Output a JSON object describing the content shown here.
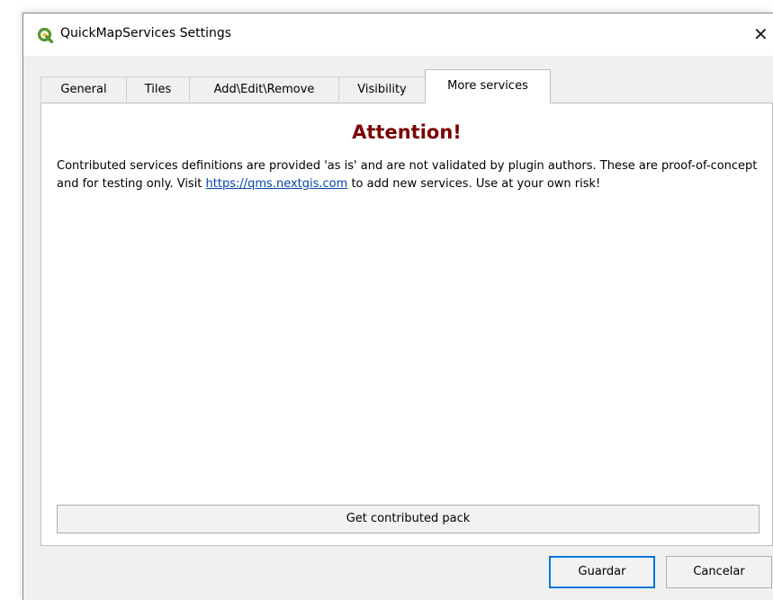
{
  "window": {
    "title": "QuickMapServices Settings",
    "close_glyph": "✕",
    "icon": "qgis-logo-icon",
    "icon_color": "#589632"
  },
  "tabs": [
    {
      "label": "General",
      "active": false
    },
    {
      "label": "Tiles",
      "active": false
    },
    {
      "label": "Add\\Edit\\Remove",
      "active": false
    },
    {
      "label": "Visibility",
      "active": false
    },
    {
      "label": "More services",
      "active": true
    }
  ],
  "more_services": {
    "heading": "Attention!",
    "heading_color": "#7a0000",
    "text_before": "Contributed services definitions are provided 'as is' and are not validated by plugin authors. These are proof-of-concept and for testing only. Visit ",
    "link_text": "https://qms.nextgis.com",
    "link_color": "#0645ad",
    "text_after": " to add new services. Use at your own risk!",
    "get_pack_label": "Get contributed pack"
  },
  "footer": {
    "save_label": "Guardar",
    "cancel_label": "Cancelar",
    "default_border_color": "#0078d7"
  }
}
